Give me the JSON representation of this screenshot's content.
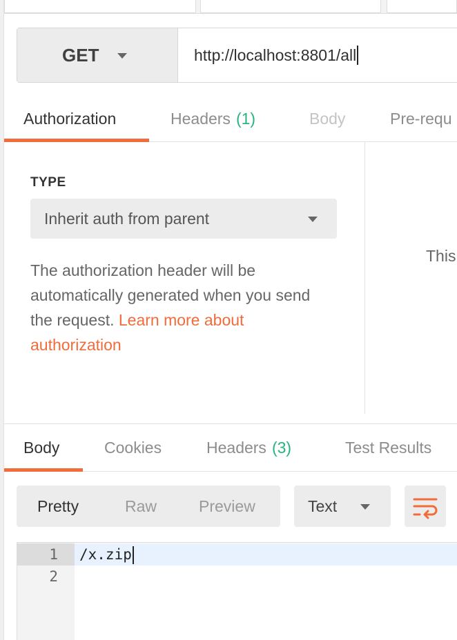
{
  "request": {
    "method": "GET",
    "url": "http://localhost:8801/all"
  },
  "request_tabs": [
    {
      "label": "Authorization"
    },
    {
      "label": "Headers",
      "count": "(1)"
    },
    {
      "label": "Body"
    },
    {
      "label": "Pre-requ"
    }
  ],
  "auth": {
    "type_label": "TYPE",
    "type_value": "Inherit auth from parent",
    "description": "The authorization header will be automatically generated when you send the request.",
    "link_text": "Learn more about authorization",
    "right_panel_text": "This"
  },
  "response_tabs": [
    {
      "label": "Body"
    },
    {
      "label": "Cookies"
    },
    {
      "label": "Headers",
      "count": "(3)"
    },
    {
      "label": "Test Results"
    }
  ],
  "response_view": {
    "modes": [
      "Pretty",
      "Raw",
      "Preview"
    ],
    "active_mode": "Pretty",
    "format": "Text",
    "wrap_icon": "wrap-lines-icon"
  },
  "editor": {
    "lines": [
      {
        "num": "1",
        "text": "/x.zip"
      },
      {
        "num": "2",
        "text": ""
      }
    ]
  },
  "colors": {
    "accent": "#f26b3a",
    "count": "#26b47f",
    "current_line": "#e8f2fe"
  }
}
